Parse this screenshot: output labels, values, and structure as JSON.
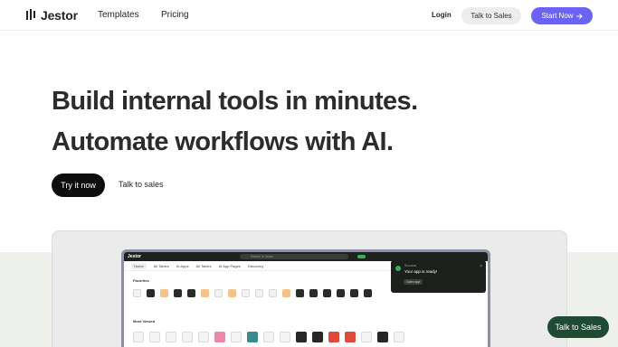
{
  "nav": {
    "brand": "Jestor",
    "links": [
      "Templates",
      "Pricing"
    ],
    "login": "Login",
    "talk_to_sales": "Talk to Sales",
    "start_now": "Start Now",
    "start_now_icon": "arrow-right-icon"
  },
  "hero": {
    "headline_line1": "Build internal tools in minutes.",
    "headline_line2": "Automate workflows with AI.",
    "primary_cta": "Try it now",
    "secondary_cta": "Talk to sales"
  },
  "preview": {
    "app_brand": "Jestor",
    "search_placeholder": "Search in Jestor",
    "tabs": [
      "Home",
      "All Tables",
      "AI Apps",
      "All Tables",
      "AI App Pages",
      "Discovery"
    ],
    "favorites_label": "Favorites",
    "most_used_label": "Most Viewed",
    "toast": {
      "small": "Success",
      "title": "Your app is ready!",
      "button": "Open app"
    }
  },
  "chat_button": "Talk to Sales",
  "colors": {
    "accent_purple": "#6b63f3",
    "chat_green": "#1f4a33",
    "band": "#eef0ec"
  }
}
